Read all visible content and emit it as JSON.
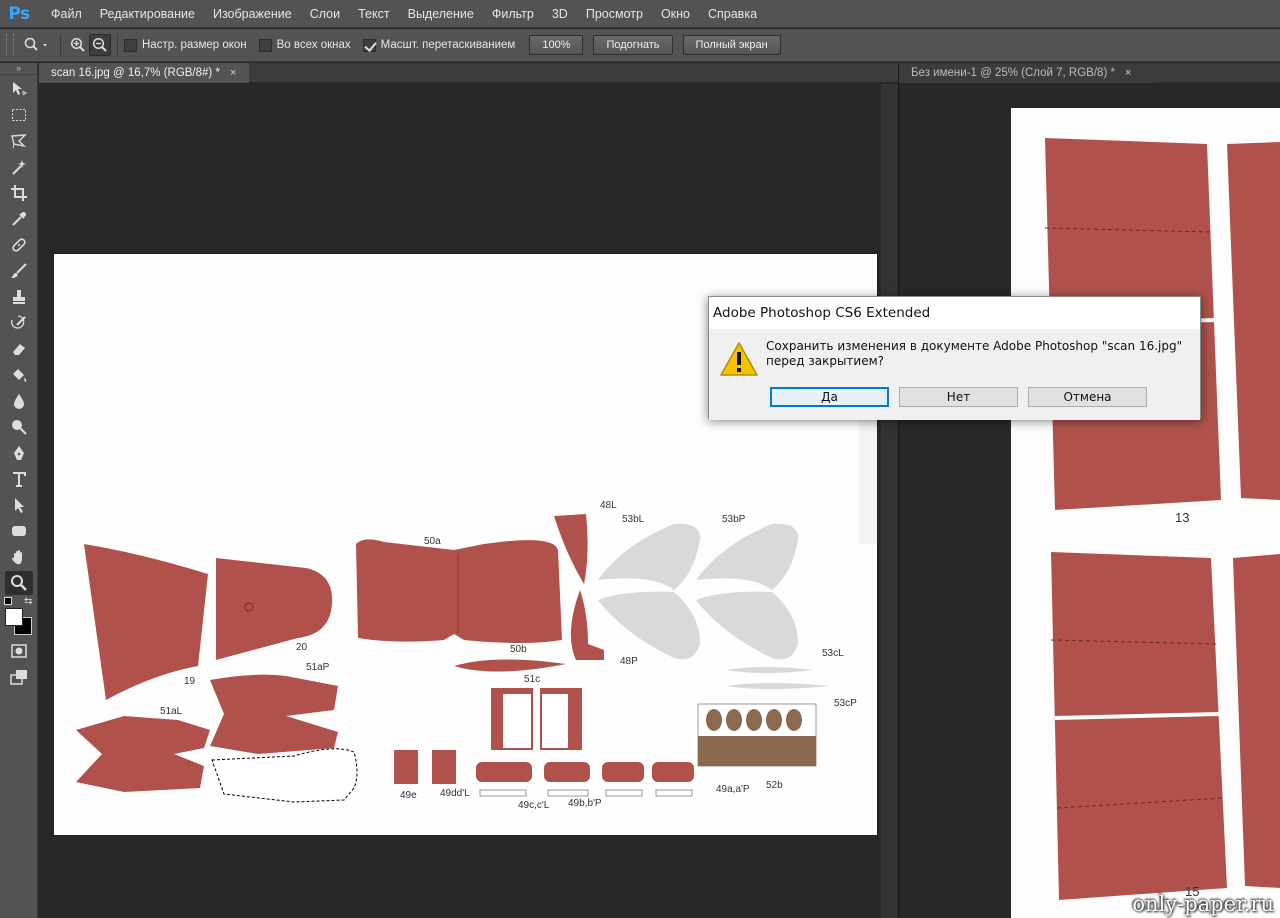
{
  "app": {
    "logo": "Ps"
  },
  "menu": [
    "Файл",
    "Редактирование",
    "Изображение",
    "Слои",
    "Текст",
    "Выделение",
    "Фильтр",
    "3D",
    "Просмотр",
    "Окно",
    "Справка"
  ],
  "options": {
    "resize_windows": "Настр. размер окон",
    "all_windows": "Во всех окнах",
    "scrubby_zoom": "Масшт. перетаскиванием",
    "btn_100": "100%",
    "btn_fit": "Подогнать",
    "btn_full": "Полный экран"
  },
  "tabs": {
    "doc1": "scan 16.jpg @ 16,7% (RGB/8#) *",
    "doc2": "Без имени-1 @ 25% (Слой 7, RGB/8) *",
    "close": "×"
  },
  "dialog": {
    "title": "Adobe Photoshop CS6 Extended",
    "message": "Сохранить изменения в документе Adobe Photoshop \"scan 16.jpg\" перед закрытием?",
    "yes": "Да",
    "no": "Нет",
    "cancel": "Отмена"
  },
  "canvas_labels": {
    "l19": "19",
    "l20": "20",
    "l50a": "50a",
    "l48L": "48L",
    "l53bL": "53bL",
    "l53bP": "53bP",
    "l48P": "48P",
    "l50b": "50b",
    "l51aP": "51aP",
    "l51aL": "51aL",
    "l51c": "51c",
    "l53cL": "53cL",
    "l53cP": "53cP",
    "l49e": "49e",
    "l49ddL": "49dd'L",
    "l49ccL": "49c,c'L",
    "l49bbP": "49b,b'P",
    "l49aaP": "49a,a'P",
    "l52b": "52b",
    "l13": "13",
    "l15": "15"
  },
  "watermark": "only-paper.ru",
  "colors": {
    "part": "#b0524b",
    "grey": "#d9d9db",
    "brown": "#8b6a50",
    "ui_dark": "#282828",
    "ui_panel": "#535353"
  }
}
